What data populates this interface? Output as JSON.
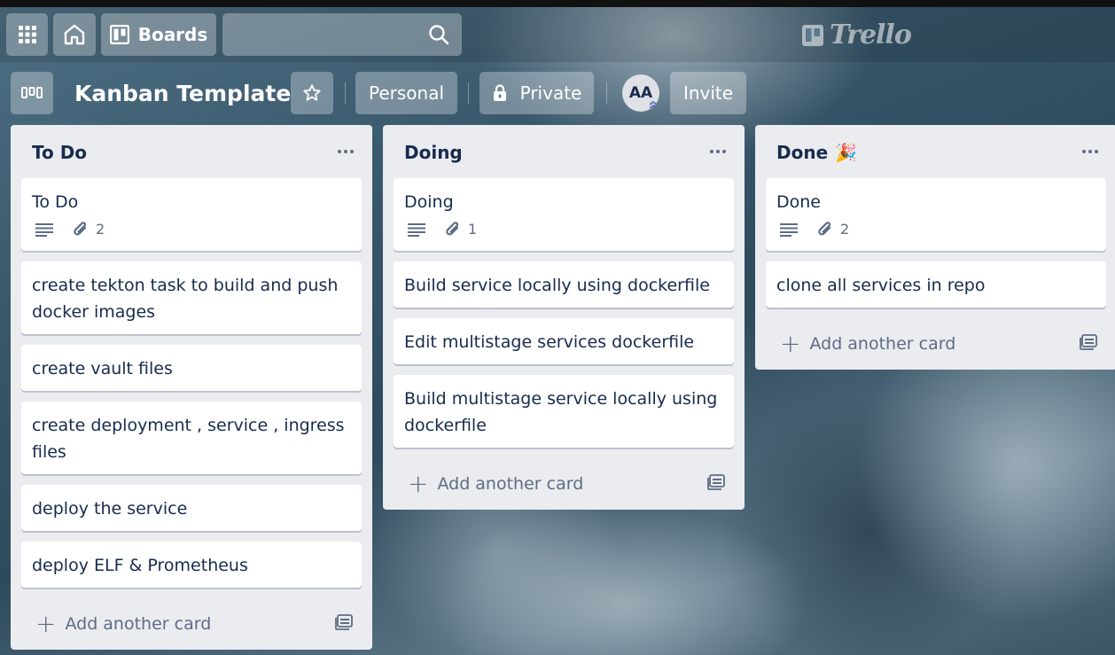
{
  "header": {
    "boards_label": "Boards",
    "search_placeholder": "",
    "logo_text": "Trello"
  },
  "board": {
    "title": "Kanban Template",
    "visibility_team": "Personal",
    "privacy": "Private",
    "avatar_initials": "AA",
    "invite_label": "Invite"
  },
  "lists": [
    {
      "title": "To Do",
      "add_label": "Add another card",
      "cards": [
        {
          "title": "To Do",
          "attachments": "2"
        },
        {
          "title": "create tekton task to build and push docker images"
        },
        {
          "title": "create vault files"
        },
        {
          "title": "create deployment , service , ingress files"
        },
        {
          "title": "deploy the service"
        },
        {
          "title": "deploy ELF & Prometheus"
        }
      ]
    },
    {
      "title": "Doing",
      "add_label": "Add another card",
      "cards": [
        {
          "title": "Doing",
          "attachments": "1"
        },
        {
          "title": "Build service locally using dockerfile"
        },
        {
          "title": "Edit multistage services dockerfile"
        },
        {
          "title": "Build multistage service locally using dockerfile"
        }
      ]
    },
    {
      "title": "Done",
      "title_emoji": "🎉",
      "add_label": "Add another card",
      "cards": [
        {
          "title": "Done",
          "attachments": "2"
        },
        {
          "title": "clone all services in repo"
        }
      ]
    }
  ]
}
